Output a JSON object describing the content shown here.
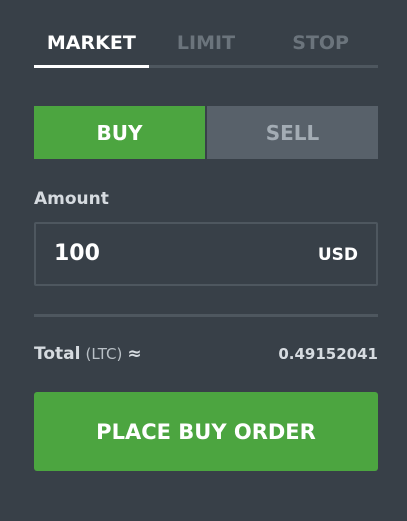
{
  "tabs": [
    {
      "label": "MARKET",
      "active": true
    },
    {
      "label": "LIMIT",
      "active": false
    },
    {
      "label": "STOP",
      "active": false
    }
  ],
  "side": {
    "buy_label": "BUY",
    "sell_label": "SELL",
    "selected": "BUY"
  },
  "amount": {
    "label": "Amount",
    "value": "100",
    "currency": "USD"
  },
  "total": {
    "label": "Total",
    "unit": "(LTC)",
    "approx_symbol": "≈",
    "value": "0.49152041"
  },
  "action": {
    "label": "PLACE BUY ORDER"
  },
  "colors": {
    "background": "#384048",
    "accent_green": "#4ca540",
    "inactive_gray": "#58616a"
  }
}
